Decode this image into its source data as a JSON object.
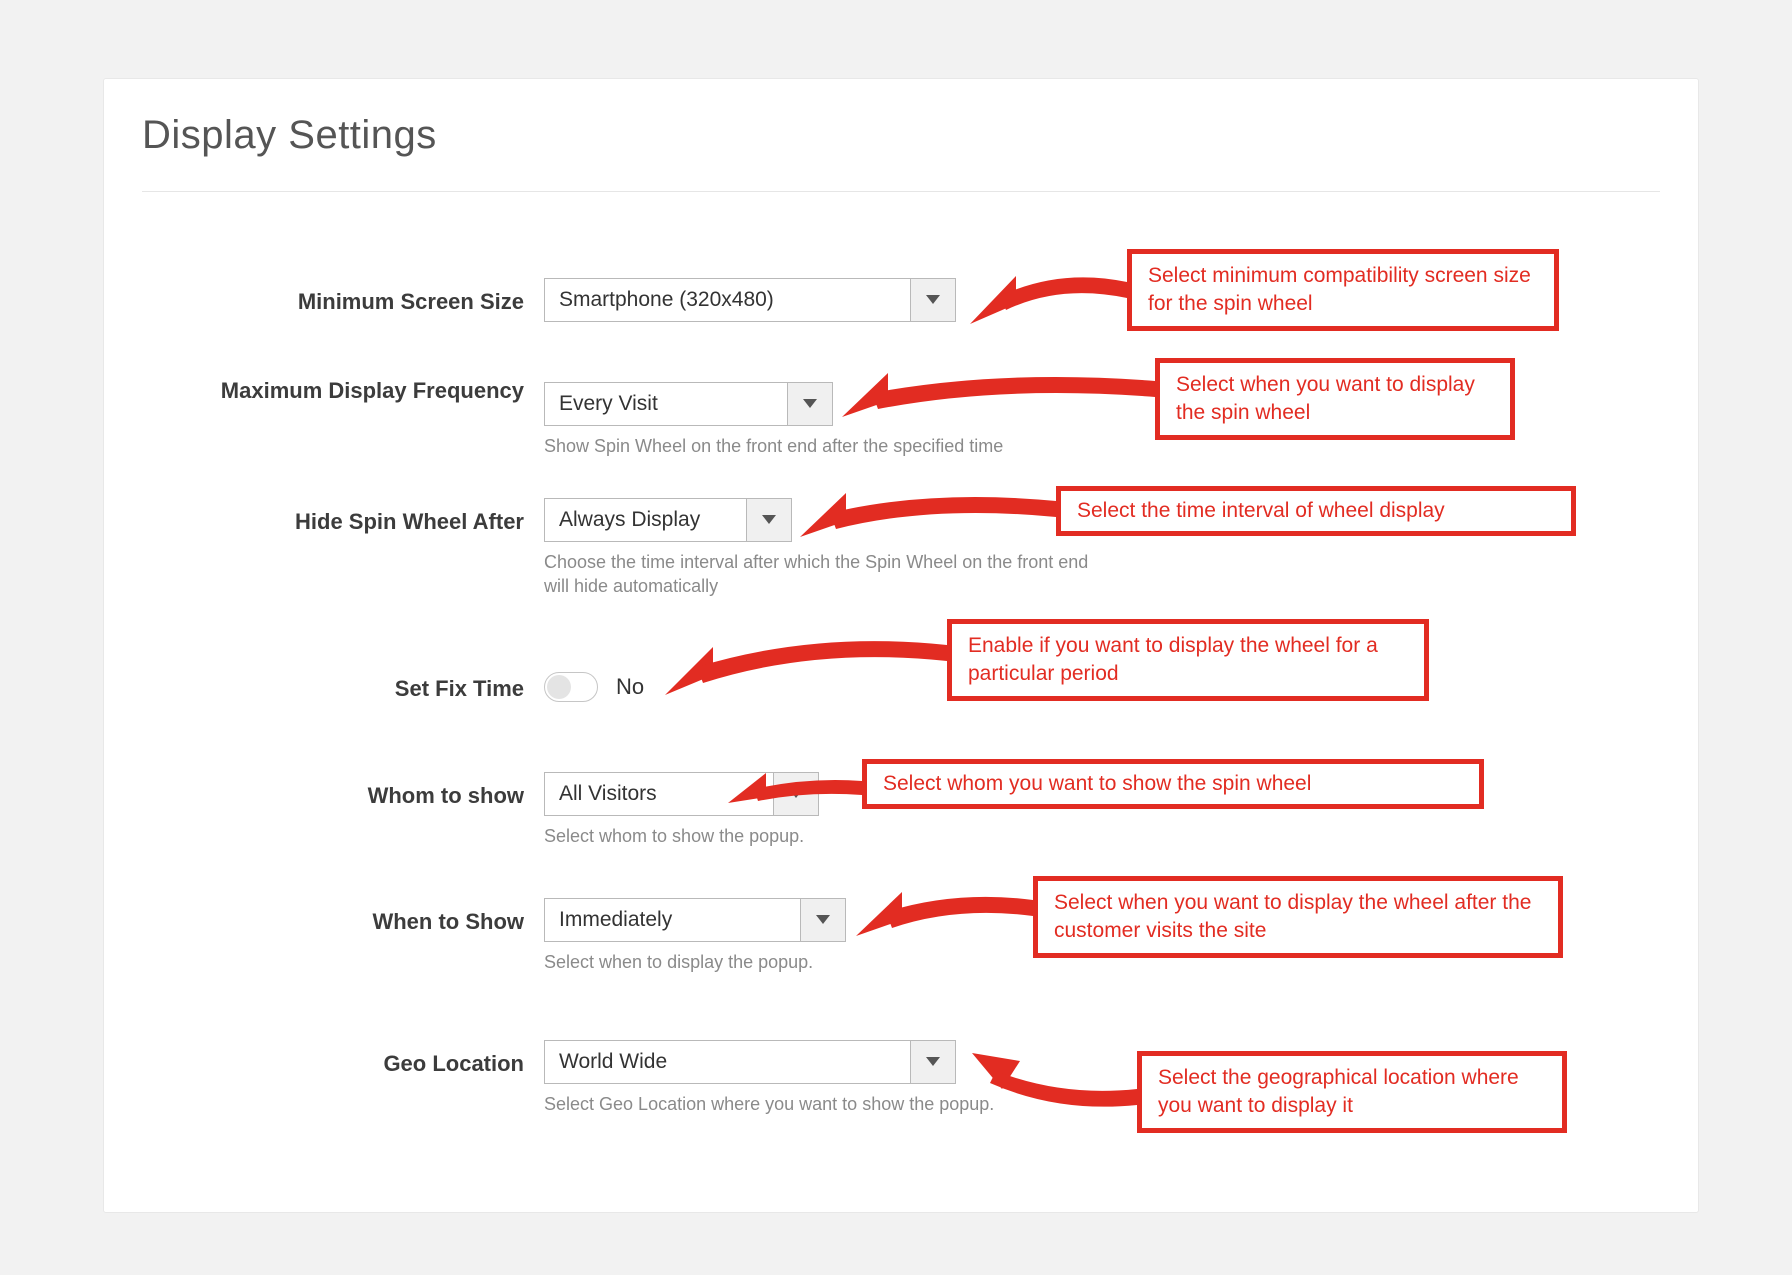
{
  "title": "Display Settings",
  "rows": {
    "min_screen": {
      "label": "Minimum Screen Size",
      "value": "Smartphone (320x480)"
    },
    "max_freq": {
      "label": "Maximum Display Frequency",
      "value": "Every Visit",
      "helper": "Show Spin Wheel on the front end after the specified time"
    },
    "hide_after": {
      "label": "Hide Spin Wheel After",
      "value": "Always Display",
      "helper": "Choose the time interval after which the Spin Wheel on the front end will hide automatically"
    },
    "fix_time": {
      "label": "Set Fix Time",
      "state_text": "No"
    },
    "whom": {
      "label": "Whom to show",
      "value": "All Visitors",
      "helper": "Select whom to show the popup."
    },
    "when": {
      "label": "When to Show",
      "value": "Immediately",
      "helper": "Select when to display the popup."
    },
    "geo": {
      "label": "Geo Location",
      "value": "World Wide",
      "helper": "Select Geo Location where you want to show the popup."
    }
  },
  "callouts": {
    "c1": "Select minimum compatibility screen size for the spin wheel",
    "c2": "Select when you want to display the spin wheel",
    "c3": "Select the time interval of wheel display",
    "c4": "Enable if you want to display the wheel for a particular period",
    "c5": "Select whom you want to show the spin wheel",
    "c6": "Select when you want to display the wheel after the customer visits the site",
    "c7": "Select the geographical location where you want to display it"
  }
}
